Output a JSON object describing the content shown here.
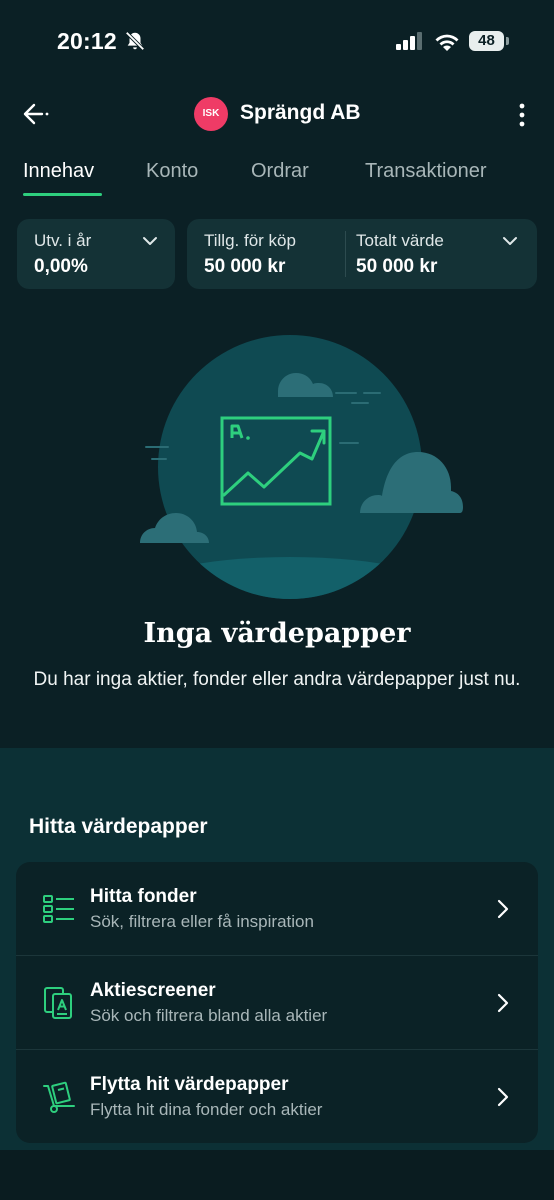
{
  "status_bar": {
    "time": "20:12",
    "battery": "48"
  },
  "header": {
    "badge": "ISK",
    "title": "Sprängd AB"
  },
  "tabs": [
    {
      "label": "Innehav",
      "active": true
    },
    {
      "label": "Konto",
      "active": false
    },
    {
      "label": "Ordrar",
      "active": false
    },
    {
      "label": "Transaktioner",
      "active": false
    }
  ],
  "summary": {
    "development": {
      "label": "Utv. i år",
      "value": "0,00%"
    },
    "available": {
      "label": "Tillg. för köp",
      "value": "50 000 kr"
    },
    "total": {
      "label": "Totalt värde",
      "value": "50 000 kr"
    }
  },
  "empty_state": {
    "title": "Inga värdepapper",
    "description": "Du har inga aktier, fonder eller andra värdepapper just nu."
  },
  "find": {
    "heading": "Hitta värdepapper",
    "items": [
      {
        "title": "Hitta fonder",
        "subtitle": "Sök, filtrera eller få inspiration",
        "icon": "list-filter-icon"
      },
      {
        "title": "Aktiescreener",
        "subtitle": "Sök och filtrera bland alla aktier",
        "icon": "stock-cards-icon"
      },
      {
        "title": "Flytta hit värdepapper",
        "subtitle": "Flytta hit dina fonder och aktier",
        "icon": "hand-truck-icon"
      }
    ]
  },
  "colors": {
    "accent": "#2ecf7e",
    "badge": "#ef3b66",
    "background": "#0b2025"
  }
}
